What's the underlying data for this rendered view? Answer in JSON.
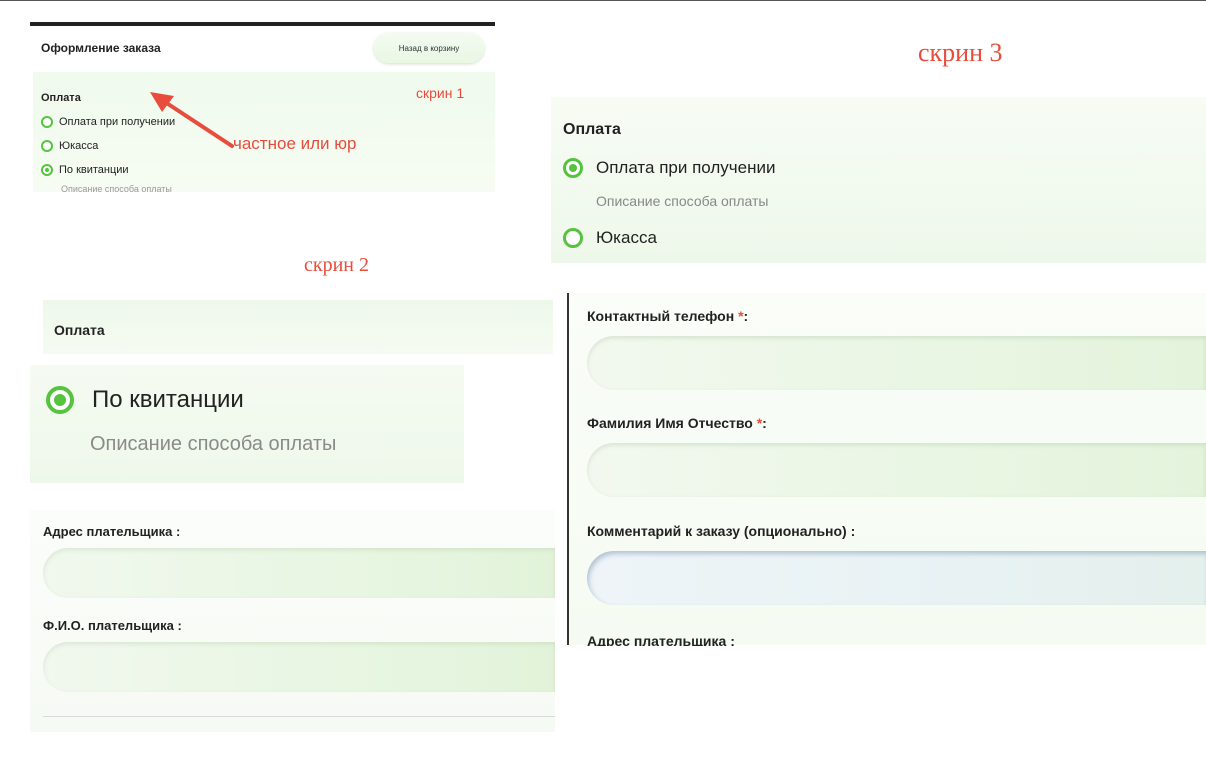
{
  "annotations": {
    "screen1_label": "скрин 1",
    "screen2_label": "скрин 2",
    "screen3_label": "скрин 3",
    "arrow_note": "частное или юр",
    "arrow_color": "#e74c3c"
  },
  "screen1": {
    "title": "Оформление заказа",
    "back_button": "Назад в корзину",
    "payment_heading": "Оплата",
    "options": [
      {
        "label": "Оплата при получении",
        "checked": false
      },
      {
        "label": "Юкасса",
        "checked": false
      },
      {
        "label": "По квитанции",
        "checked": true
      }
    ],
    "description": "Описание способа оплаты"
  },
  "screen2": {
    "payment_heading": "Оплата",
    "selected_option": "По квитанции",
    "description": "Описание способа оплаты",
    "fields": [
      {
        "label": "Адрес плательщика :",
        "value": ""
      },
      {
        "label": "Ф.И.О. плательщика :",
        "value": ""
      }
    ]
  },
  "screen3": {
    "payment_heading": "Оплата",
    "options": [
      {
        "label": "Оплата при получении",
        "checked": true
      },
      {
        "label": "Юкасса",
        "checked": false
      }
    ],
    "description": "Описание способа оплаты",
    "fields": [
      {
        "label": "Контактный телефон ",
        "required_mark": "*",
        "suffix": ":",
        "value": ""
      },
      {
        "label": "Фамилия Имя Отчество ",
        "required_mark": "*",
        "suffix": ":",
        "value": ""
      },
      {
        "label": "Комментарий к заказу (опционально) :",
        "value": ""
      }
    ],
    "partial_label": "Адрес плательщика :"
  },
  "colors": {
    "accent_green": "#56c33f",
    "required_red": "#e74c3c"
  }
}
